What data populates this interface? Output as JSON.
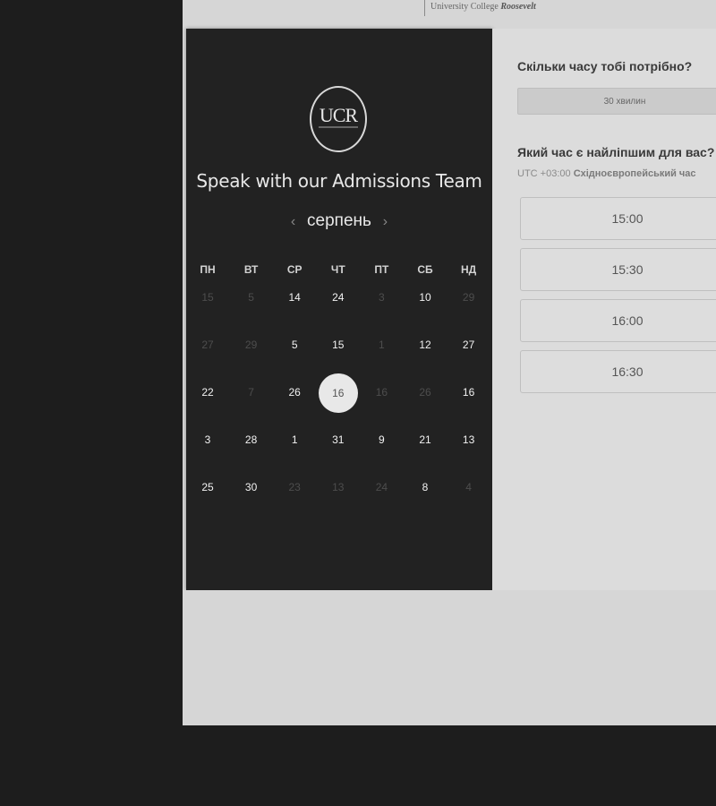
{
  "brand": {
    "prefix": "University College ",
    "name": "Roosevelt"
  },
  "calendar": {
    "logo_text": "UCR",
    "headline": "Speak with our Admissions Team",
    "prev_icon": "chevron-left-icon",
    "next_icon": "chevron-right-icon",
    "prev_glyph": "‹",
    "next_glyph": "›",
    "month": "серпень",
    "weekdays": [
      "ПН",
      "ВТ",
      "СР",
      "ЧТ",
      "ПТ",
      "СБ",
      "НД"
    ],
    "weeks": [
      [
        {
          "d": "15",
          "muted": true
        },
        {
          "d": "5",
          "muted": true
        },
        {
          "d": "14",
          "muted": false
        },
        {
          "d": "24",
          "muted": false
        },
        {
          "d": "3",
          "muted": true
        },
        {
          "d": "10",
          "muted": false
        },
        {
          "d": "29",
          "muted": true
        }
      ],
      [
        {
          "d": "27",
          "muted": true
        },
        {
          "d": "29",
          "muted": true
        },
        {
          "d": "5",
          "muted": false
        },
        {
          "d": "15",
          "muted": false
        },
        {
          "d": "1",
          "muted": true
        },
        {
          "d": "12",
          "muted": false
        },
        {
          "d": "27",
          "muted": false
        }
      ],
      [
        {
          "d": "22",
          "muted": false
        },
        {
          "d": "7",
          "muted": true
        },
        {
          "d": "26",
          "muted": false
        },
        {
          "d": "16",
          "muted": false,
          "selected": true
        },
        {
          "d": "16",
          "muted": true
        },
        {
          "d": "26",
          "muted": true
        },
        {
          "d": "16",
          "muted": false
        }
      ],
      [
        {
          "d": "3",
          "muted": false
        },
        {
          "d": "28",
          "muted": false
        },
        {
          "d": "1",
          "muted": false
        },
        {
          "d": "31",
          "muted": false
        },
        {
          "d": "9",
          "muted": false
        },
        {
          "d": "21",
          "muted": false
        },
        {
          "d": "13",
          "muted": false
        }
      ],
      [
        {
          "d": "25",
          "muted": false
        },
        {
          "d": "30",
          "muted": false
        },
        {
          "d": "23",
          "muted": true
        },
        {
          "d": "13",
          "muted": true
        },
        {
          "d": "24",
          "muted": true
        },
        {
          "d": "8",
          "muted": false
        },
        {
          "d": "4",
          "muted": true
        }
      ]
    ]
  },
  "booking": {
    "duration_question": "Скільки часу тобі потрібно?",
    "duration_value": "30 хвилин",
    "time_question": "Який час є найліпшим для вас?",
    "timezone_offset": "UTC +03:00",
    "timezone_name": "Східноєвропейський час",
    "slots": [
      "15:00",
      "15:30",
      "16:00",
      "16:30"
    ]
  },
  "colors": {
    "background": "#1d1d1d",
    "calendar_panel": "#222222",
    "booking_panel": "#dcdcdc",
    "selected_day": "#e8e8e8"
  }
}
